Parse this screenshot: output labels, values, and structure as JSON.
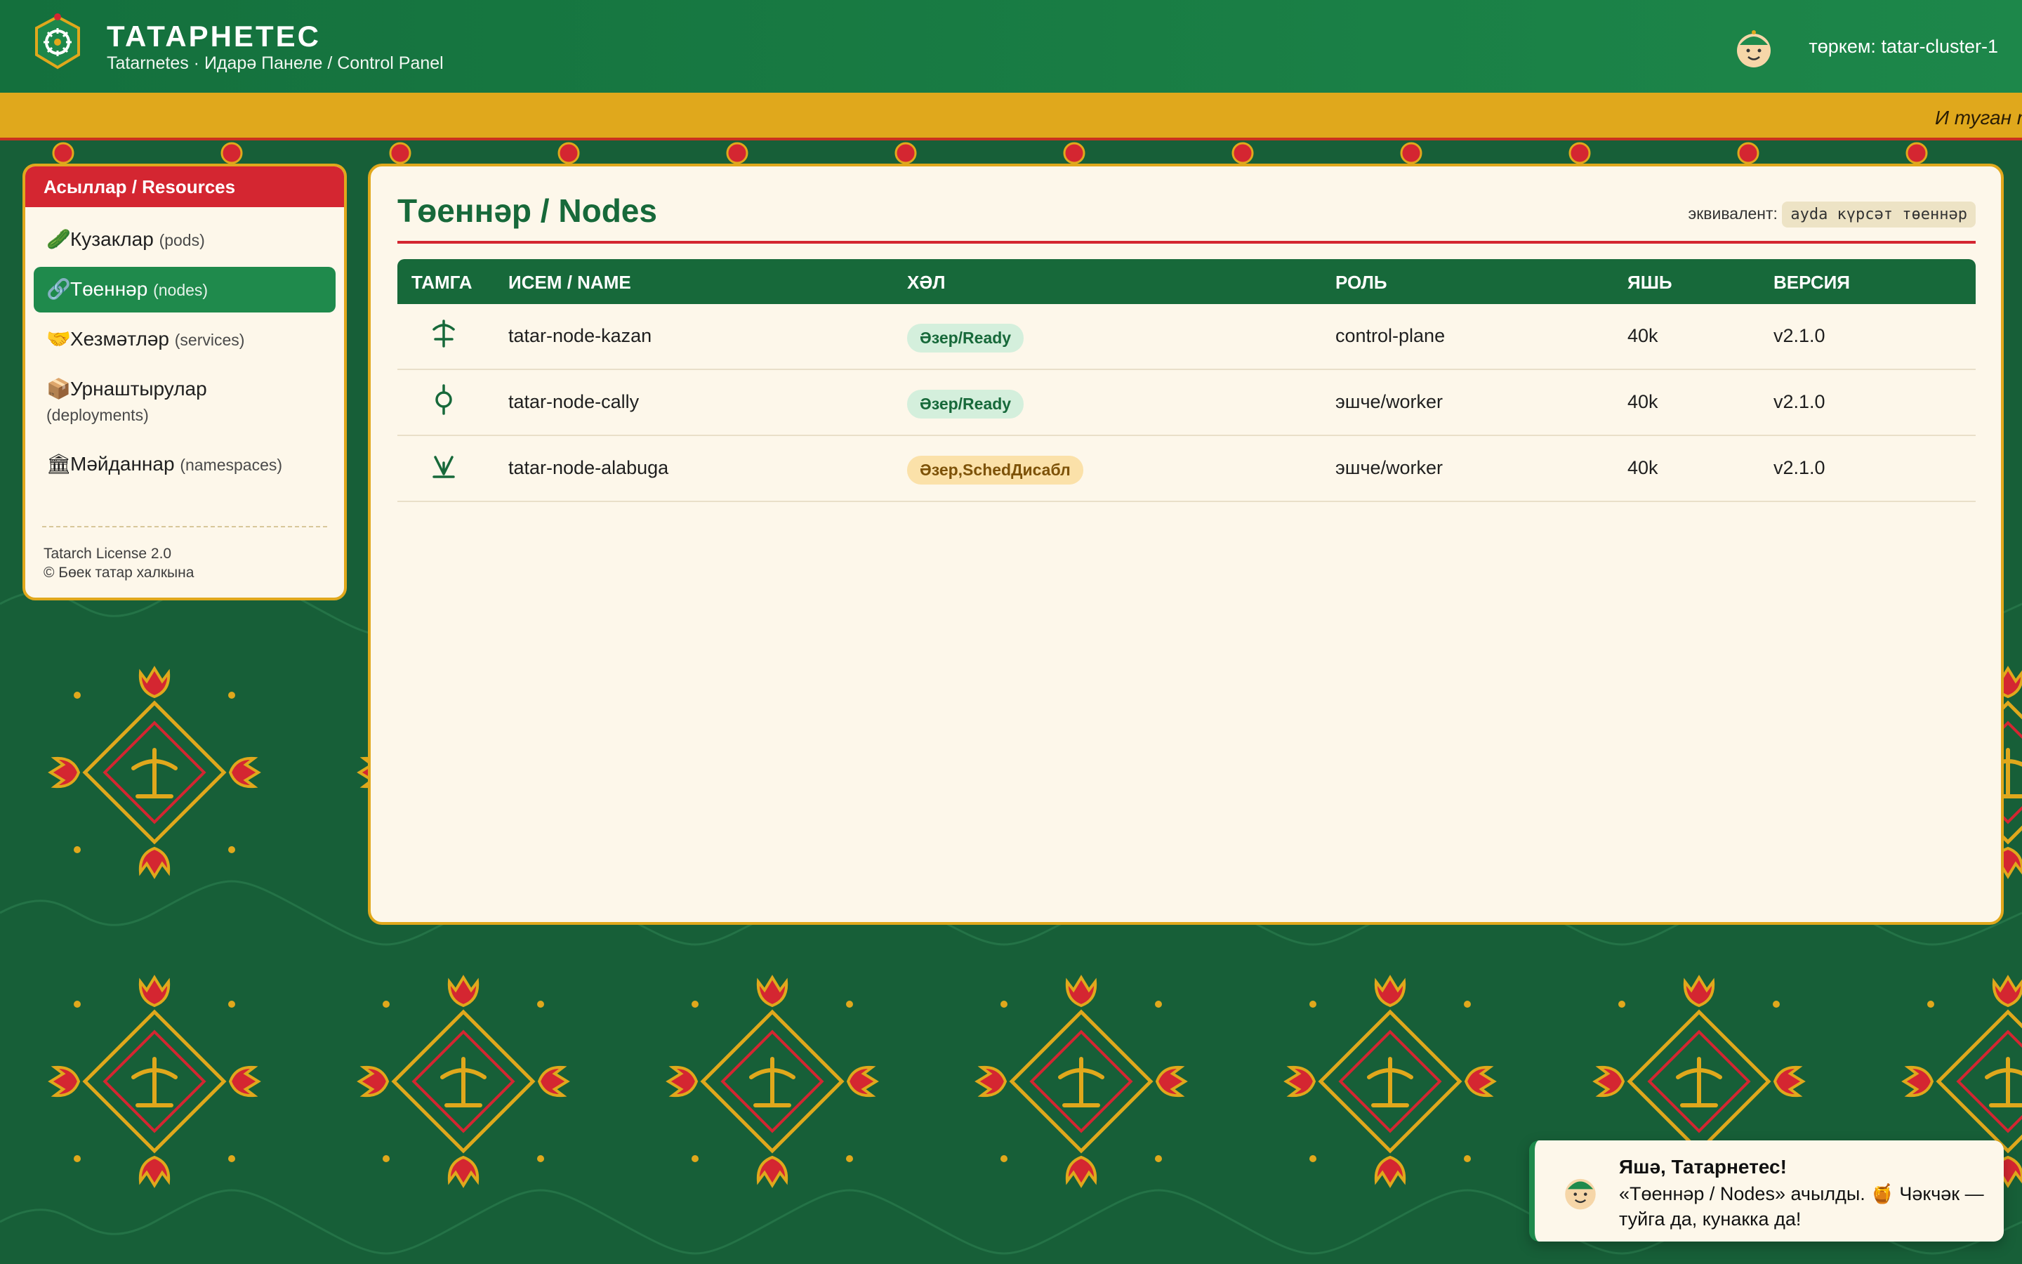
{
  "header": {
    "title": "ТАТАРНЕТЕС",
    "subtitle": "Tatarnetes · Идарә Панеле / Control Panel",
    "cluster_label": "төркем: tatar-cluster-1"
  },
  "ticker": {
    "text": "И туган т"
  },
  "sidebar": {
    "heading": "Асыллар / Resources",
    "items": [
      {
        "icon": "cucumber-icon",
        "glyph": "🥒",
        "label": "Кузаклар",
        "sub": "(pods)",
        "active": false
      },
      {
        "icon": "link-icon",
        "glyph": "🔗",
        "label": "Төеннәр",
        "sub": "(nodes)",
        "active": true
      },
      {
        "icon": "handshake-icon",
        "glyph": "🤝",
        "label": "Хезмәтләр",
        "sub": "(services)",
        "active": false
      },
      {
        "icon": "package-icon",
        "glyph": "📦",
        "label": "Урнаштырулар",
        "sub": "(deployments)",
        "active": false
      },
      {
        "icon": "landmark-icon",
        "glyph": "🏛",
        "label": "Мәйданнар",
        "sub": "(namespaces)",
        "active": false
      }
    ],
    "footer_line1": "Tatarch License 2.0",
    "footer_line2": "© Бөек татар халкына"
  },
  "main": {
    "title": "Төеннәр / Nodes",
    "equivalent_label": "эквивалент:",
    "equivalent_command": "ayda күрсәт төеннәр",
    "columns": [
      "ТАМГА",
      "ИСЕМ / NAME",
      "ХӘЛ",
      "РОЛЬ",
      "ЯШЬ",
      "ВЕРСИЯ"
    ],
    "rows": [
      {
        "tamga": "tamga-anchor-icon",
        "name": "tatar-node-kazan",
        "status": "Әзер/Ready",
        "status_kind": "ok",
        "role": "control-plane",
        "age": "40k",
        "version": "v2.1.0"
      },
      {
        "tamga": "tamga-circle-icon",
        "name": "tatar-node-cally",
        "status": "Әзер/Ready",
        "status_kind": "ok",
        "role": "эшче/worker",
        "age": "40k",
        "version": "v2.1.0"
      },
      {
        "tamga": "tamga-fork-icon",
        "name": "tatar-node-alabuga",
        "status": "Әзер,SchedДисабл",
        "status_kind": "warn",
        "role": "эшче/worker",
        "age": "40k",
        "version": "v2.1.0"
      }
    ]
  },
  "toast": {
    "title": "Яшә, Татарнетес!",
    "body": "«Төеннәр / Nodes» ачылды. 🍯 Чәкчәк — туйга да, кунакка да!"
  },
  "colors": {
    "green_dark": "#175f38",
    "green": "#1f8a4c",
    "gold": "#e0a81c",
    "red": "#d42631",
    "cream": "#fdf7ea"
  }
}
